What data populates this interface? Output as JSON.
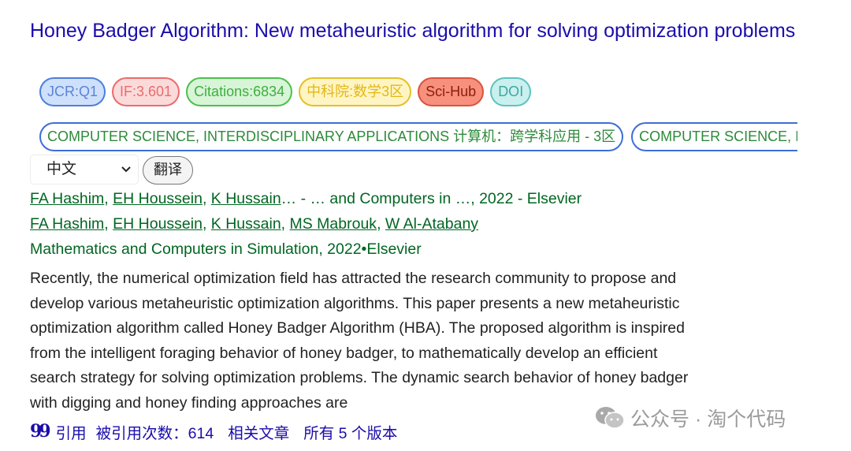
{
  "result": {
    "title": "Honey Badger Algorithm: New metaheuristic algorithm for solving optimization problems",
    "badges": {
      "jcr": "JCR:Q1",
      "impact_factor": "IF:3.601",
      "citations": "Citations:6834",
      "cas_zone": "中科院:数学3区",
      "scihub": "Sci-Hub",
      "doi": "DOI"
    },
    "categories": [
      "COMPUTER SCIENCE, INTERDISCIPLINARY APPLICATIONS 计算机：跨学科应用 - 3区",
      "COMPUTER SCIENCE, INTERDISCIPLINARY APPLICATIONS"
    ],
    "language_select": {
      "selected": "中文"
    },
    "translate_label": "翻译",
    "short_authors": {
      "a1": "FA Hashim",
      "a2": "EH Houssein",
      "a3": "K Hussain",
      "suffix": "… - … and Computers in …, 2022 - Elsevier"
    },
    "full_authors": [
      "FA Hashim",
      "EH Houssein",
      "K Hussain",
      "MS Mabrouk",
      "W Al-Atabany"
    ],
    "journal_line": "Mathematics and Computers in Simulation, 2022•Elsevier",
    "abstract": "Recently, the numerical optimization field has attracted the research community to propose and develop various metaheuristic optimization algorithms. This paper presents a new metaheuristic optimization algorithm called Honey Badger Algorithm (HBA). The proposed algorithm is inspired from the intelligent foraging behavior of honey badger, to mathematically develop an efficient search strategy for solving optimization problems. The dynamic search behavior of honey badger with digging and honey finding approaches are",
    "footer": {
      "quote_icon": "99",
      "cite_label": "引用",
      "cited_by": "被引用次数：614",
      "related": "相关文章",
      "versions": "所有 5 个版本"
    }
  },
  "watermark": {
    "text": "公众号 · 淘个代码",
    "icon": "wechat-icon"
  },
  "colors": {
    "title": "#1a0dab",
    "green": "#006621",
    "jcr": "#5a84d6",
    "if": "#ea6d6d",
    "citations": "#3fae3f",
    "cas": "#e2b812",
    "scihub": "#d9553f",
    "doi": "#3fa6a3"
  }
}
